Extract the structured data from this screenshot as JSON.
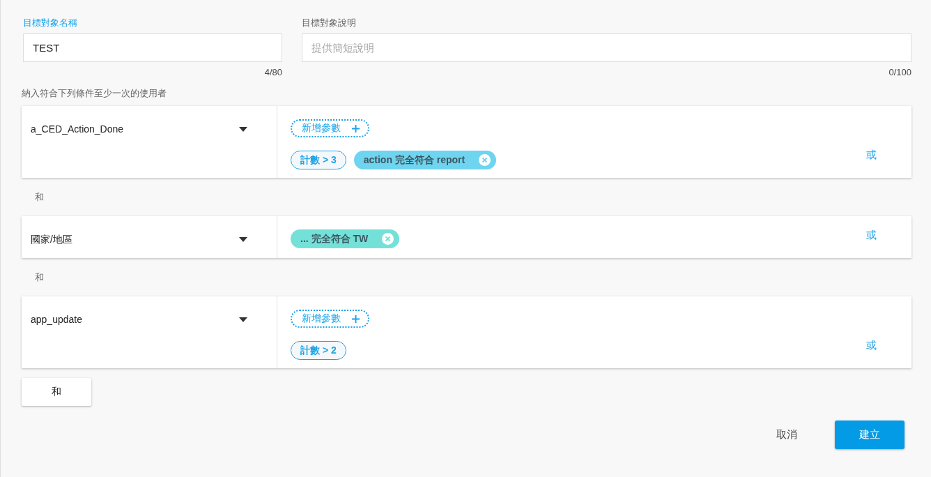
{
  "fields": [
    {
      "label": "目標對象名稱",
      "focused": true,
      "value": "TEST",
      "counter": "4/80"
    },
    {
      "label": "目標對象說明",
      "focused": false,
      "placeholder": "提供簡短說明",
      "counter": "0/100"
    }
  ],
  "conditions_heading": "納入符合下列條件至少一次的使用者",
  "conditions": [
    {
      "event": "a_CED_Action_Done",
      "add_param": "新增參數",
      "chips": [
        {
          "kind": "count",
          "text": "計數 > 3"
        },
        {
          "kind": "filter",
          "text": "action 完全符合 report",
          "color": "#6fd4ef"
        }
      ],
      "or_label": "或",
      "joiner": "和"
    },
    {
      "event": "國家/地區",
      "chips": [
        {
          "kind": "filter",
          "text": "... 完全符合 TW",
          "color": "#74e1d9"
        }
      ],
      "or_label": "或",
      "joiner": "和"
    },
    {
      "event": "app_update",
      "add_param": "新增參數",
      "chips": [
        {
          "kind": "count",
          "text": "計數 > 2"
        }
      ],
      "or_label": "或"
    }
  ],
  "and_button": "和",
  "footer": {
    "cancel": "取消",
    "create": "建立"
  }
}
